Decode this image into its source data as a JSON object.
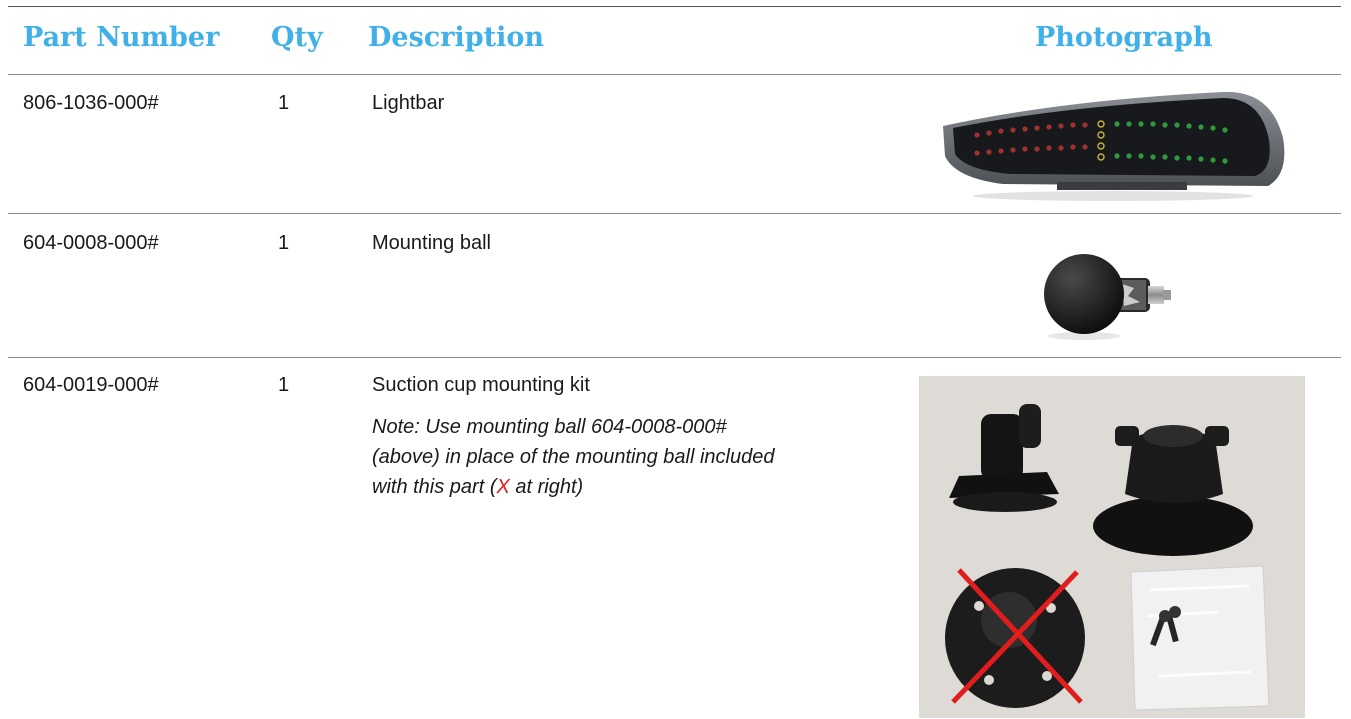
{
  "headers": {
    "part_number": "Part Number",
    "qty": "Qty",
    "description": "Description",
    "photograph": "Photograph"
  },
  "rows": [
    {
      "part_number": "806-1036-000#",
      "qty": "1",
      "description": "Lightbar",
      "photo_icon": "lightbar-photo"
    },
    {
      "part_number": "604-0008-000#",
      "qty": "1",
      "description": "Mounting ball",
      "photo_icon": "mounting-ball-photo"
    },
    {
      "part_number": "604-0019-000#",
      "qty": "1",
      "description": "Suction cup mounting kit",
      "note_before": "Note: Use mounting ball 604-0008-000# (above) in place of the mounting ball included with this part (",
      "note_x": "X",
      "note_after": " at right)",
      "photo_icon": "suction-cup-kit-photo"
    }
  ],
  "colors": {
    "header_text": "#3fb0e8",
    "x_mark": "#e21d1d"
  }
}
